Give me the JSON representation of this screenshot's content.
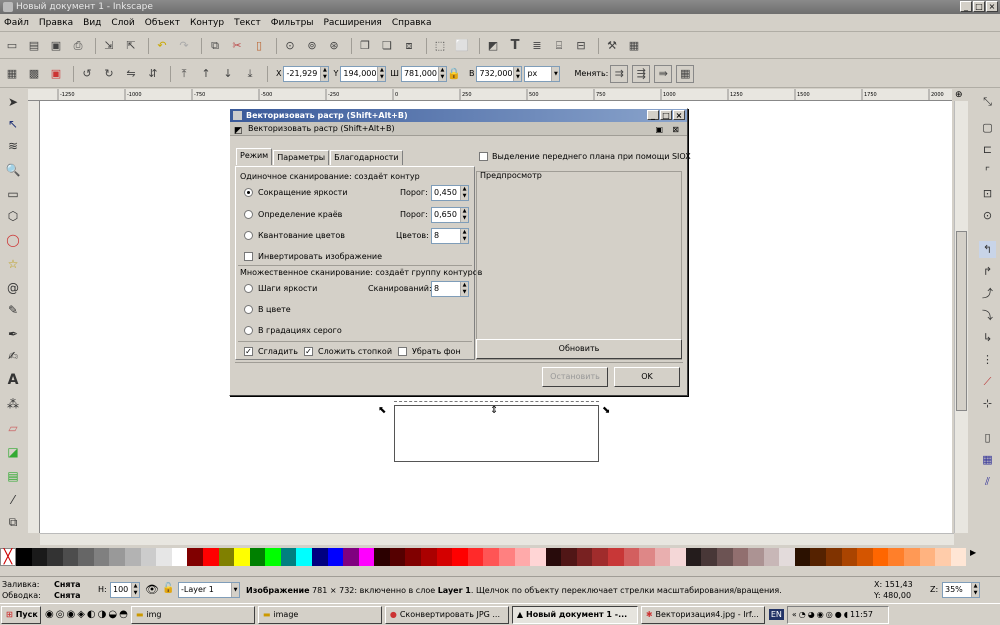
{
  "window": {
    "title": "Новый документ 1 - Inkscape"
  },
  "menu": [
    "Файл",
    "Правка",
    "Вид",
    "Слой",
    "Объект",
    "Контур",
    "Текст",
    "Фильтры",
    "Расширения",
    "Справка"
  ],
  "toolbar2": {
    "x_label": "X",
    "x_value": "-21,929",
    "y_label": "Y",
    "y_value": "194,000",
    "w_label": "Ш",
    "w_value": "781,000",
    "h_label": "В",
    "h_value": "732,000",
    "unit": "px",
    "change_label": "Менять:"
  },
  "ruler_ticks": [
    "-1250",
    "-1000",
    "-750",
    "-500",
    "-250",
    "0",
    "250",
    "500",
    "750",
    "1000",
    "1250",
    "1500",
    "1750",
    "2000"
  ],
  "dialog": {
    "title": "Векторизовать растр (Shift+Alt+B)",
    "subtitle": "Векторизовать растр (Shift+Alt+B)",
    "tabs": [
      "Режим",
      "Параметры",
      "Благодарности"
    ],
    "single_scan_label": "Одиночное сканирование: создаёт контур",
    "brightness_cutoff": "Сокращение яркости",
    "threshold_label": "Порог:",
    "brightness_threshold": "0,450",
    "edge_detection": "Определение краёв",
    "edge_threshold": "0,650",
    "color_quant": "Квантование цветов",
    "colors_label": "Цветов:",
    "colors_value": "8",
    "invert": "Инвертировать изображение",
    "multi_scan_label": "Множественное сканирование: создаёт группу контуров",
    "brightness_steps": "Шаги яркости",
    "scans_label": "Сканирований:",
    "scans_value": "8",
    "in_color": "В цвете",
    "grayscale": "В градациях серого",
    "smooth": "Сгладить",
    "stack": "Сложить стопкой",
    "remove_bg": "Убрать фон",
    "siox": "Выделение переднего плана при помощи SIOX",
    "preview_label": "Предпросмотр",
    "update": "Обновить",
    "stop": "Остановить",
    "ok": "OK"
  },
  "status": {
    "fill_label": "Заливка:",
    "fill_value": "Снята",
    "stroke_label": "Обводка:",
    "stroke_value": "Снята",
    "h_label": "Н:",
    "h_value": "100",
    "layer": "-Layer 1",
    "message_bold": "Изображение",
    "message": " 781 × 732: включенно в слое ",
    "message_layer": "Layer 1",
    "message_tail": ". Щелчок по объекту переключает стрелки масштабирования/вращения.",
    "x_coord": "X: 151,43",
    "y_coord": "Y: 480,00",
    "z_label": "Z:",
    "zoom": "35%"
  },
  "taskbar": {
    "start": "Пуск",
    "tasks": [
      "img",
      "image",
      "Сконвертировать JPG ...",
      "Новый документ 1 -...",
      "Векторизация4.jpg - Irf..."
    ],
    "lang": "EN",
    "clock": "11:57"
  },
  "palette": [
    "#000000",
    "#1a1a1a",
    "#333333",
    "#4d4d4d",
    "#666666",
    "#808080",
    "#999999",
    "#b3b3b3",
    "#cccccc",
    "#e6e6e6",
    "#ffffff",
    "#800000",
    "#ff0000",
    "#808000",
    "#ffff00",
    "#008000",
    "#00ff00",
    "#008080",
    "#00ffff",
    "#000080",
    "#0000ff",
    "#800080",
    "#ff00ff",
    "#2b0000",
    "#550000",
    "#800000",
    "#aa0000",
    "#d40000",
    "#ff0000",
    "#ff2a2a",
    "#ff5555",
    "#ff8080",
    "#ffaaaa",
    "#ffd5d5",
    "#280b0b",
    "#501616",
    "#782121",
    "#a02c2c",
    "#c83737",
    "#d35f5f",
    "#de8787",
    "#e9afaf",
    "#f4d7d7",
    "#241c1c",
    "#483737",
    "#6c5353",
    "#916f6f",
    "#ac9393",
    "#c8b7b7",
    "#e3dbdb",
    "#2b1100",
    "#552200",
    "#803300",
    "#aa4400",
    "#d45500",
    "#ff6600",
    "#ff7f2a",
    "#ff9955",
    "#ffb380",
    "#ffccaa",
    "#ffe6d5"
  ]
}
